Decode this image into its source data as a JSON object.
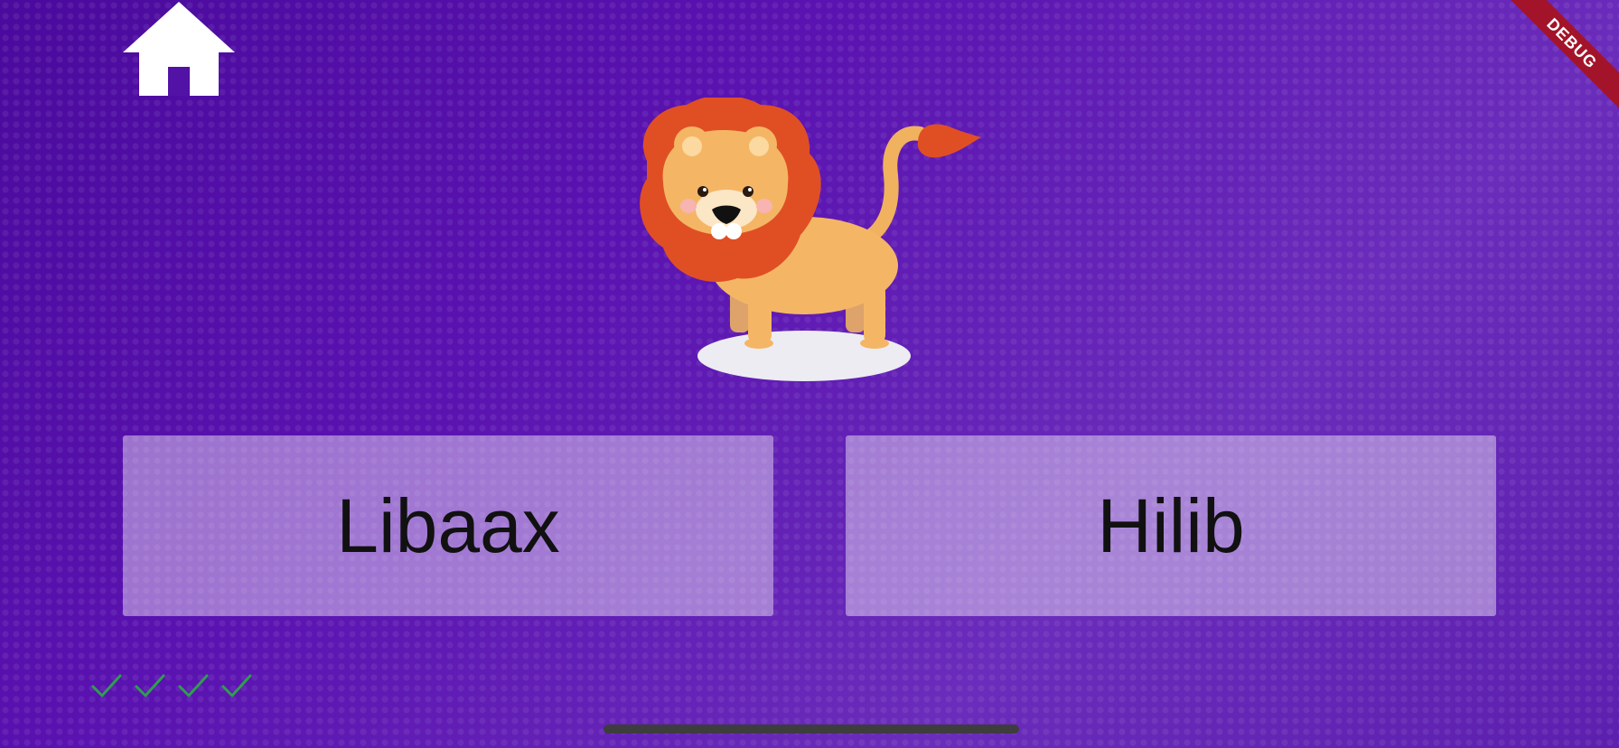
{
  "header": {
    "home_icon": "home-icon"
  },
  "debug_banner": {
    "label": "DEBUG"
  },
  "question": {
    "image": "lion-illustration"
  },
  "choices": [
    {
      "label": "Libaax"
    },
    {
      "label": "Hilib"
    }
  ],
  "progress": {
    "icon": "checkmark-icon",
    "correct_count": 4,
    "color": "#2e9e4f"
  },
  "colors": {
    "background": "#5212a6",
    "choice_bg": "#ffffff",
    "choice_text": "#111111",
    "debug_red": "#a3142a"
  }
}
